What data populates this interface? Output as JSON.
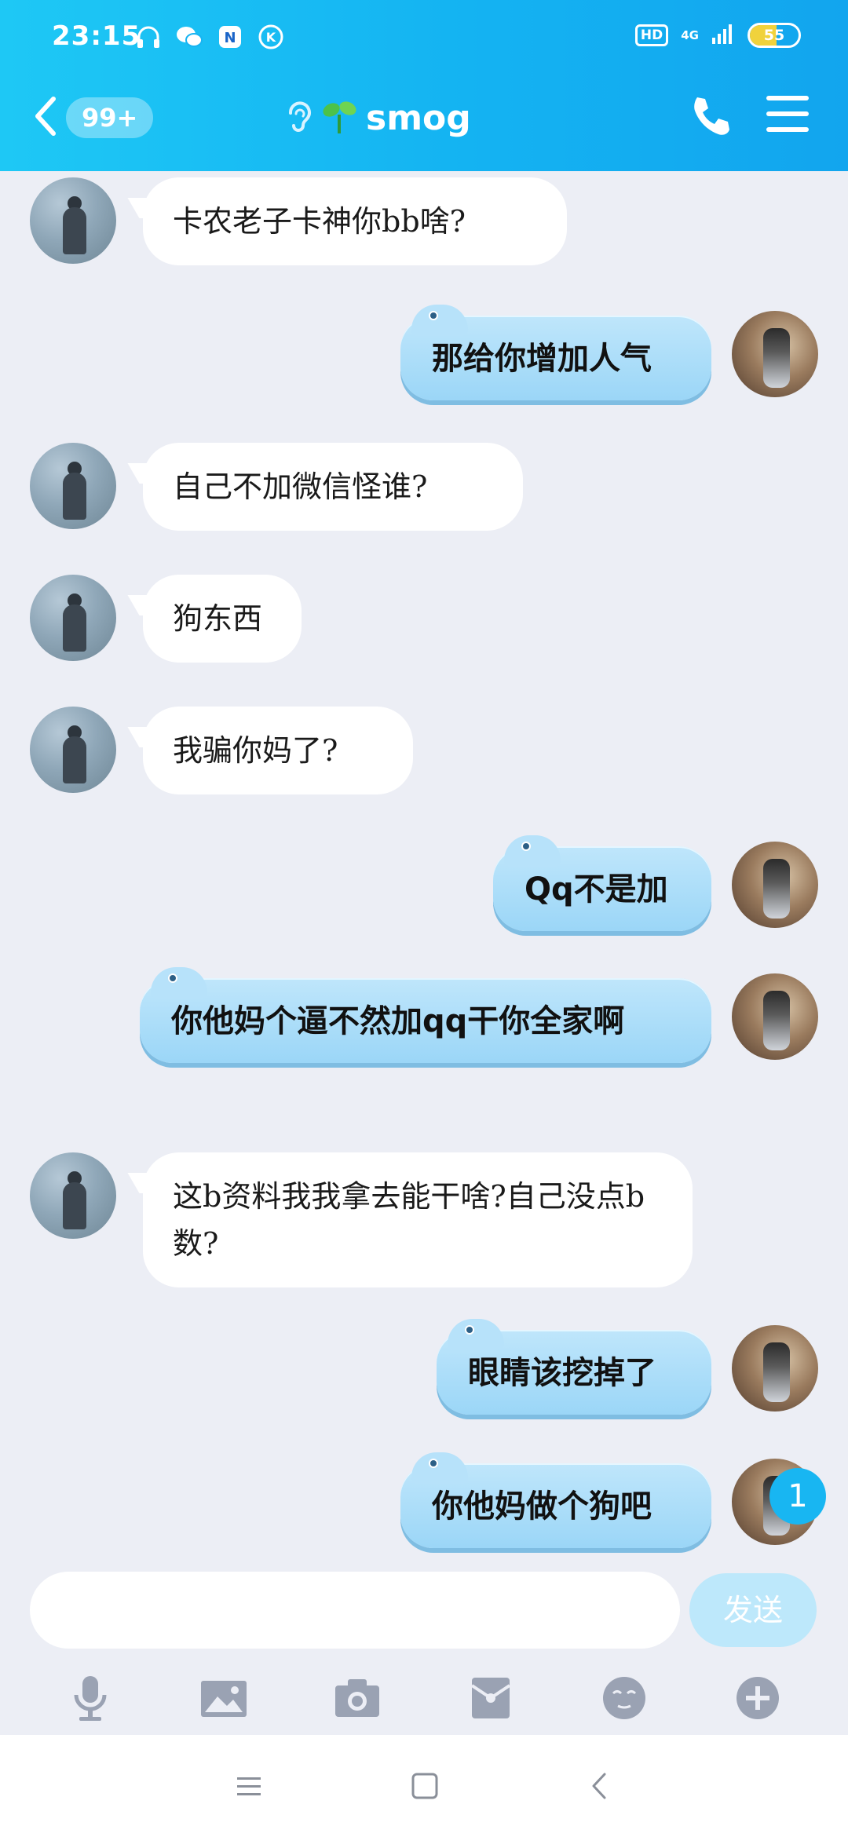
{
  "status": {
    "time": "23:15",
    "icons": [
      "headphones-icon",
      "wechat-icon",
      "n-app-icon",
      "k-app-icon"
    ],
    "hd": "HD",
    "network": "4G",
    "battery": "55",
    "battery_level": 0.55
  },
  "header": {
    "unread": "99+",
    "title": "smog"
  },
  "messages": [
    {
      "side": "left",
      "text": "卡农老子卡神你bb啥?"
    },
    {
      "side": "right",
      "text": "那给你增加人气"
    },
    {
      "side": "left",
      "text": "自己不加微信怪谁?"
    },
    {
      "side": "left",
      "text": "狗东西"
    },
    {
      "side": "left",
      "text": "我骗你妈了?"
    },
    {
      "side": "right",
      "text": "Qq不是加"
    },
    {
      "side": "right",
      "text": "你他妈个逼不然加qq干你全家啊"
    },
    {
      "side": "left",
      "text": "这b资料我我拿去能干啥?自己没点b数?"
    },
    {
      "side": "right",
      "text": "眼睛该挖掉了"
    },
    {
      "side": "right",
      "text": "你他妈做个狗吧"
    }
  ],
  "badge": "1",
  "input": {
    "value": "",
    "placeholder": "",
    "send_label": "发送"
  },
  "colors": {
    "header": "#15b4f2",
    "right_bubble": "#a9dcf8",
    "left_bubble": "#ffffff",
    "background": "#eceef5"
  }
}
